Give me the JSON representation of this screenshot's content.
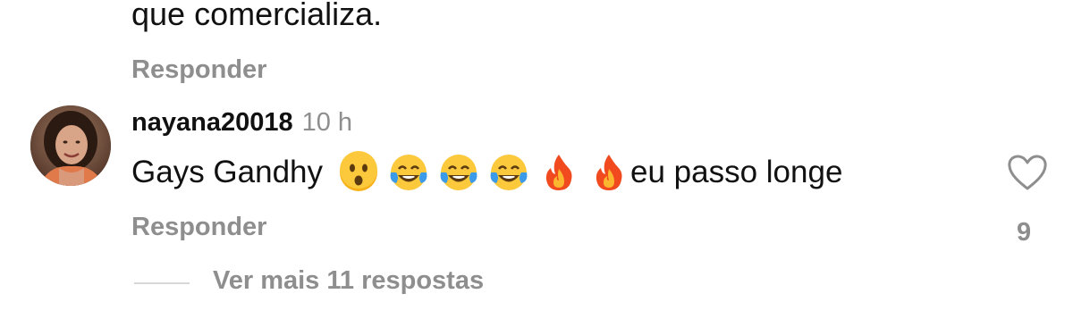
{
  "previous_comment": {
    "text_tail": "que comercializa.",
    "reply_label": "Responder"
  },
  "comment": {
    "username": "nayana20018",
    "timestamp": "10 h",
    "text_before_emoji": "Gays Gandhy",
    "emojis": [
      "hushed-face",
      "tears-of-joy",
      "tears-of-joy",
      "tears-of-joy",
      "fire",
      "fire"
    ],
    "text_after_emoji": "eu passo longe",
    "reply_label": "Responder",
    "like_count": "9"
  },
  "more_replies": {
    "label": "Ver mais 11 respostas"
  },
  "colors": {
    "text_primary": "#111111",
    "text_secondary": "#8e8e8e",
    "divider": "#d7d7d7"
  }
}
